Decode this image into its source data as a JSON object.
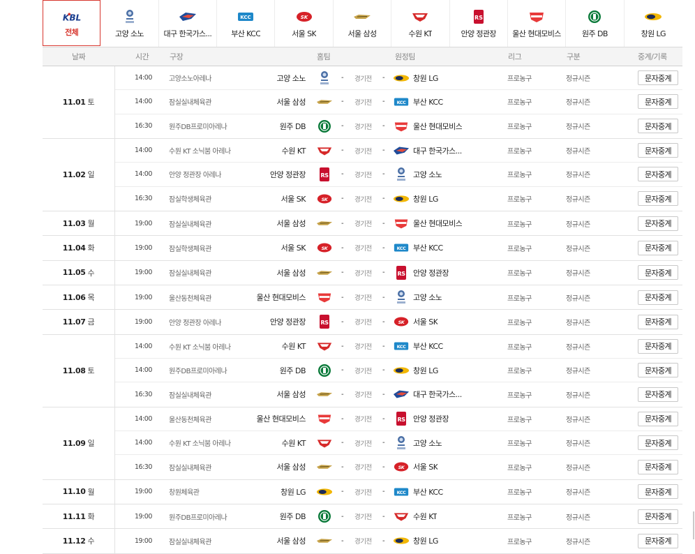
{
  "tabs": [
    {
      "name": "전체",
      "icon": "kbl-logo-icon",
      "active": true
    },
    {
      "name": "고양 소노",
      "icon": "sono-logo-icon"
    },
    {
      "name": "대구 한국가스...",
      "icon": "gas-logo-icon"
    },
    {
      "name": "부산 KCC",
      "icon": "kcc-logo-icon"
    },
    {
      "name": "서울 SK",
      "icon": "sk-logo-icon"
    },
    {
      "name": "서울 삼성",
      "icon": "samsung-logo-icon"
    },
    {
      "name": "수원 KT",
      "icon": "kt-logo-icon"
    },
    {
      "name": "안양 정관장",
      "icon": "jgj-logo-icon"
    },
    {
      "name": "울산 현대모비스",
      "icon": "mobis-logo-icon"
    },
    {
      "name": "원주 DB",
      "icon": "db-logo-icon"
    },
    {
      "name": "창원 LG",
      "icon": "lg-logo-icon"
    }
  ],
  "headers": {
    "date": "날짜",
    "time": "시간",
    "venue": "구장",
    "home": "홈팀",
    "away": "원정팀",
    "league": "리그",
    "type": "구분",
    "broadcast": "중계/기록"
  },
  "colors": {
    "accent": "#d7342c"
  },
  "score_text": "경기전",
  "dash": "-",
  "league_text": "프로농구",
  "type_text": "정규시즌",
  "button_text": "문자중계",
  "schedule": [
    {
      "date": "11.01",
      "dow": "토",
      "games": [
        {
          "time": "14:00",
          "venue": "고양소노아레나",
          "home": "고양 소노",
          "hlogo": "sono",
          "away": "창원 LG",
          "alogo": "lg"
        },
        {
          "time": "14:00",
          "venue": "잠실실내체육관",
          "home": "서울 삼성",
          "hlogo": "samsung",
          "away": "부산 KCC",
          "alogo": "kcc"
        },
        {
          "time": "16:30",
          "venue": "원주DB프로미아레나",
          "home": "원주 DB",
          "hlogo": "db",
          "away": "울산 현대모비스",
          "alogo": "mobis"
        }
      ]
    },
    {
      "date": "11.02",
      "dow": "일",
      "games": [
        {
          "time": "14:00",
          "venue": "수원 KT 소닉붐 아레나",
          "home": "수원 KT",
          "hlogo": "kt",
          "away": "대구 한국가스...",
          "alogo": "gas"
        },
        {
          "time": "14:00",
          "venue": "안양 정관장 아레나",
          "home": "안양 정관장",
          "hlogo": "jgj",
          "away": "고양 소노",
          "alogo": "sono"
        },
        {
          "time": "16:30",
          "venue": "잠실학생체육관",
          "home": "서울 SK",
          "hlogo": "sk",
          "away": "창원 LG",
          "alogo": "lg"
        }
      ]
    },
    {
      "date": "11.03",
      "dow": "월",
      "games": [
        {
          "time": "19:00",
          "venue": "잠실실내체육관",
          "home": "서울 삼성",
          "hlogo": "samsung",
          "away": "울산 현대모비스",
          "alogo": "mobis"
        }
      ]
    },
    {
      "date": "11.04",
      "dow": "화",
      "games": [
        {
          "time": "19:00",
          "venue": "잠실학생체육관",
          "home": "서울 SK",
          "hlogo": "sk",
          "away": "부산 KCC",
          "alogo": "kcc"
        }
      ]
    },
    {
      "date": "11.05",
      "dow": "수",
      "games": [
        {
          "time": "19:00",
          "venue": "잠실실내체육관",
          "home": "서울 삼성",
          "hlogo": "samsung",
          "away": "안양 정관장",
          "alogo": "jgj"
        }
      ]
    },
    {
      "date": "11.06",
      "dow": "목",
      "games": [
        {
          "time": "19:00",
          "venue": "울산동천체육관",
          "home": "울산 현대모비스",
          "hlogo": "mobis",
          "away": "고양 소노",
          "alogo": "sono"
        }
      ]
    },
    {
      "date": "11.07",
      "dow": "금",
      "games": [
        {
          "time": "19:00",
          "venue": "안양 정관장 아레나",
          "home": "안양 정관장",
          "hlogo": "jgj",
          "away": "서울 SK",
          "alogo": "sk"
        }
      ]
    },
    {
      "date": "11.08",
      "dow": "토",
      "games": [
        {
          "time": "14:00",
          "venue": "수원 KT 소닉붐 아레나",
          "home": "수원 KT",
          "hlogo": "kt",
          "away": "부산 KCC",
          "alogo": "kcc"
        },
        {
          "time": "14:00",
          "venue": "원주DB프로미아레나",
          "home": "원주 DB",
          "hlogo": "db",
          "away": "창원 LG",
          "alogo": "lg"
        },
        {
          "time": "16:30",
          "venue": "잠실실내체육관",
          "home": "서울 삼성",
          "hlogo": "samsung",
          "away": "대구 한국가스...",
          "alogo": "gas"
        }
      ]
    },
    {
      "date": "11.09",
      "dow": "일",
      "games": [
        {
          "time": "14:00",
          "venue": "울산동천체육관",
          "home": "울산 현대모비스",
          "hlogo": "mobis",
          "away": "안양 정관장",
          "alogo": "jgj"
        },
        {
          "time": "14:00",
          "venue": "수원 KT 소닉붐 아레나",
          "home": "수원 KT",
          "hlogo": "kt",
          "away": "고양 소노",
          "alogo": "sono"
        },
        {
          "time": "16:30",
          "venue": "잠실실내체육관",
          "home": "서울 삼성",
          "hlogo": "samsung",
          "away": "서울 SK",
          "alogo": "sk"
        }
      ]
    },
    {
      "date": "11.10",
      "dow": "월",
      "games": [
        {
          "time": "19:00",
          "venue": "창원체육관",
          "home": "창원 LG",
          "hlogo": "lg",
          "away": "부산 KCC",
          "alogo": "kcc"
        }
      ]
    },
    {
      "date": "11.11",
      "dow": "화",
      "games": [
        {
          "time": "19:00",
          "venue": "원주DB프로미아레나",
          "home": "원주 DB",
          "hlogo": "db",
          "away": "수원 KT",
          "alogo": "kt"
        }
      ]
    },
    {
      "date": "11.12",
      "dow": "수",
      "games": [
        {
          "time": "19:00",
          "venue": "잠실실내체육관",
          "home": "서울 삼성",
          "hlogo": "samsung",
          "away": "창원 LG",
          "alogo": "lg"
        }
      ]
    }
  ]
}
